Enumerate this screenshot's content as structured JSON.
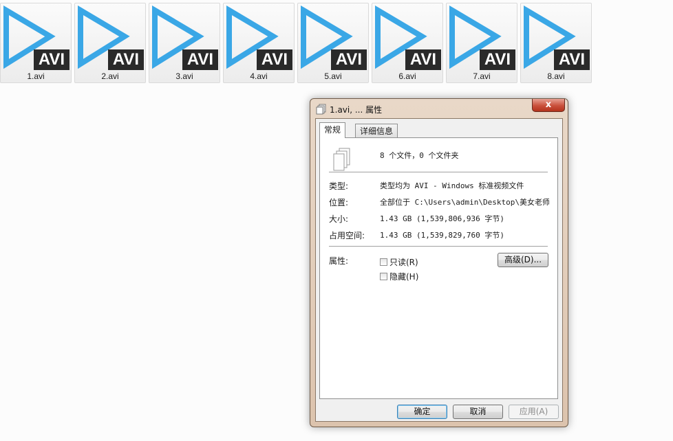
{
  "files": [
    {
      "name": "1.avi",
      "badge": "AVI"
    },
    {
      "name": "2.avi",
      "badge": "AVI"
    },
    {
      "name": "3.avi",
      "badge": "AVI"
    },
    {
      "name": "4.avi",
      "badge": "AVI"
    },
    {
      "name": "5.avi",
      "badge": "AVI"
    },
    {
      "name": "6.avi",
      "badge": "AVI"
    },
    {
      "name": "7.avi",
      "badge": "AVI"
    },
    {
      "name": "8.avi",
      "badge": "AVI"
    }
  ],
  "colors": {
    "play_accent": "#3aa7e6",
    "badge_bg": "#2a2a2a"
  },
  "dialog": {
    "title": "1.avi, ... 属性",
    "close_label": "x",
    "tabs": [
      {
        "label": "常规",
        "active": true
      },
      {
        "label": "详细信息",
        "active": false
      }
    ],
    "general": {
      "summary": "8 个文件，0 个文件夹",
      "type_label": "类型:",
      "type_value": "类型均为 AVI - Windows 标准视频文件",
      "location_label": "位置:",
      "location_value": "全部位于 C:\\Users\\admin\\Desktop\\美女老师上",
      "size_label": "大小:",
      "size_value": "1.43 GB (1,539,806,936 字节)",
      "disk_size_label": "占用空间:",
      "disk_size_value": "1.43 GB (1,539,829,760 字节)",
      "attributes_label": "属性:",
      "readonly_label": "只读(R)",
      "hidden_label": "隐藏(H)",
      "advanced_label": "高级(D)..."
    },
    "buttons": {
      "ok": "确定",
      "cancel": "取消",
      "apply": "应用(A)"
    }
  }
}
